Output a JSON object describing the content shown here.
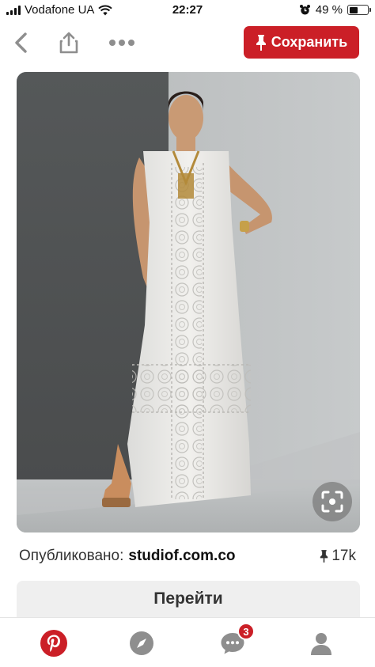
{
  "status_bar": {
    "carrier": "Vodafone UA",
    "time": "22:27",
    "battery_percent": "49 %",
    "battery_level": 0.49,
    "icons": [
      "signal-bars-icon",
      "wifi-icon",
      "alarm-icon",
      "battery-icon"
    ]
  },
  "toolbar": {
    "back_icon": "chevron-left-icon",
    "share_icon": "share-upload-icon",
    "more_icon": "more-dots-icon",
    "save_label": "Сохранить",
    "save_icon": "pin-icon",
    "accent": "#cb1f27"
  },
  "pin": {
    "zoom_icon": "visual-search-icon"
  },
  "source": {
    "prefix": "Опубликовано:",
    "host": "studiof.com.co",
    "save_count": "17k",
    "save_icon": "pin-icon"
  },
  "visit_button": {
    "label": "Перейти"
  },
  "bottom_nav": {
    "items": [
      {
        "icon": "pinterest-logo-icon"
      },
      {
        "icon": "compass-icon"
      },
      {
        "icon": "messages-icon",
        "badge": "3"
      },
      {
        "icon": "profile-icon"
      }
    ]
  }
}
